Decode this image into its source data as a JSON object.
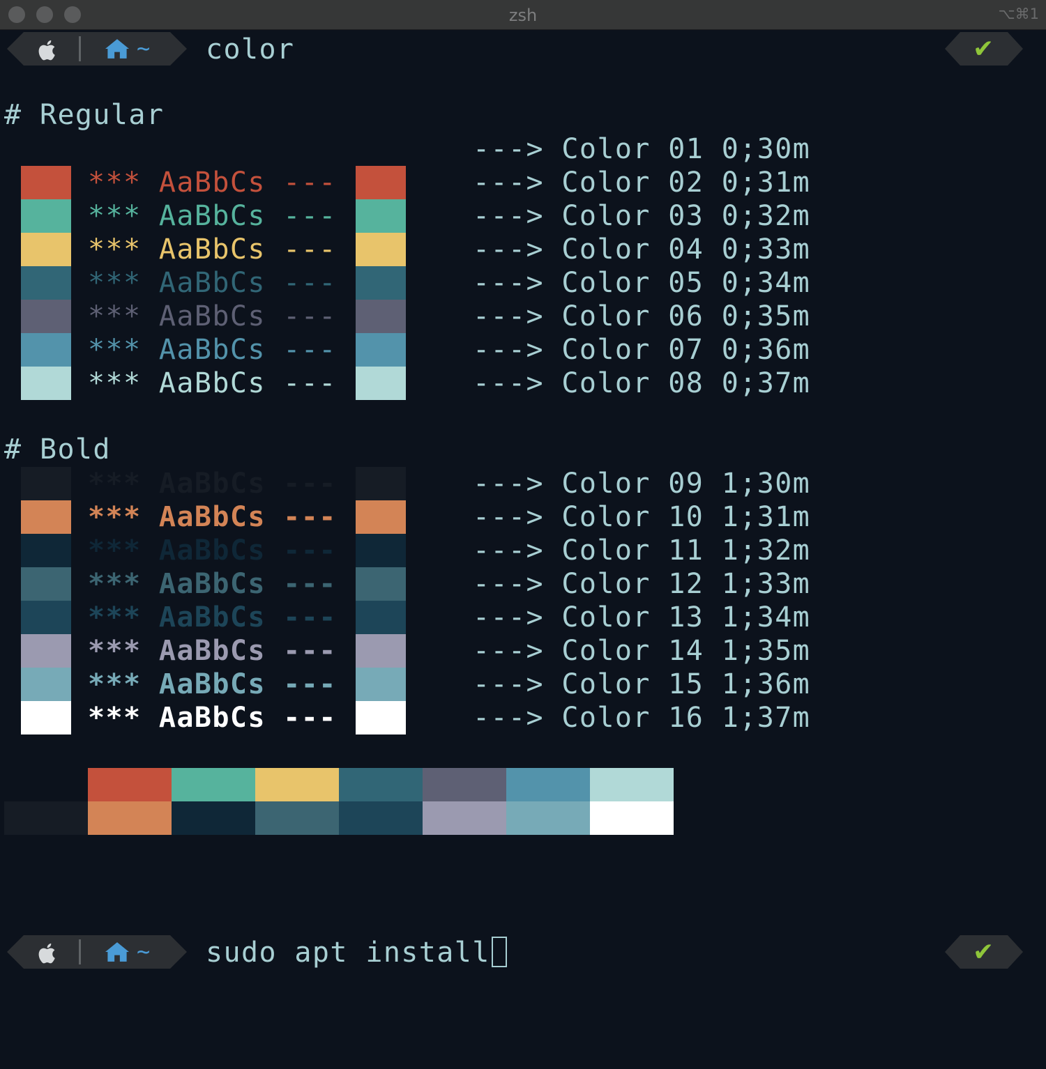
{
  "window": {
    "title": "zsh",
    "shortcut": "⌥⌘1"
  },
  "prompt": {
    "path": "~",
    "status_icon": "✔"
  },
  "commands": {
    "first": "color",
    "second": "sudo apt install"
  },
  "headings": {
    "regular": "# Regular",
    "bold": "# Bold"
  },
  "sample_text": "*** AaBbCs ---",
  "regular_first_label": "---> Color 01 0;30m",
  "regular": [
    {
      "label": "---> Color 02 0;31m",
      "color": "#c4513c"
    },
    {
      "label": "---> Color 03 0;32m",
      "color": "#56b39d"
    },
    {
      "label": "---> Color 04 0;33m",
      "color": "#e8c46b"
    },
    {
      "label": "---> Color 05 0;34m",
      "color": "#316676"
    },
    {
      "label": "---> Color 06 0;35m",
      "color": "#5e6074"
    },
    {
      "label": "---> Color 07 0;36m",
      "color": "#5393ab"
    },
    {
      "label": "---> Color 08 0;37m",
      "color": "#b1d9d7"
    }
  ],
  "bold": [
    {
      "label": "---> Color 09 1;30m",
      "color": "#161c25"
    },
    {
      "label": "---> Color 10 1;31m",
      "color": "#d38456"
    },
    {
      "label": "---> Color 11 1;32m",
      "color": "#0f2737"
    },
    {
      "label": "---> Color 12 1;33m",
      "color": "#3c6572"
    },
    {
      "label": "---> Color 13 1;34m",
      "color": "#1d4558"
    },
    {
      "label": "---> Color 14 1;35m",
      "color": "#9b9ab0"
    },
    {
      "label": "---> Color 15 1;36m",
      "color": "#77aab7"
    },
    {
      "label": "---> Color 16 1;37m",
      "color": "#ffffff"
    }
  ],
  "palette_top": [
    "#c4513c",
    "#56b39d",
    "#e8c46b",
    "#316676",
    "#5e6074",
    "#5393ab",
    "#b1d9d7"
  ],
  "palette_bottom": [
    "#161c25",
    "#d38456",
    "#0f2737",
    "#3c6572",
    "#1d4558",
    "#9b9ab0",
    "#77aab7",
    "#ffffff"
  ]
}
